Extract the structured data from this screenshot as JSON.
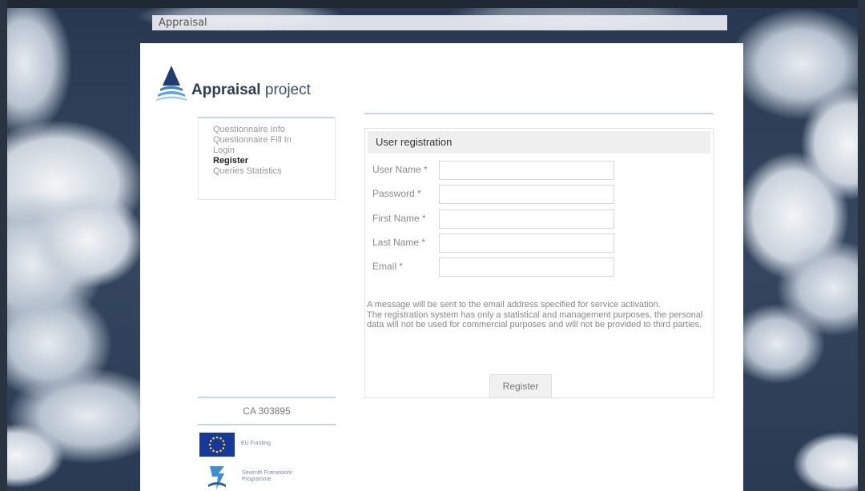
{
  "window_title": "Appraisal",
  "brand": {
    "bold": "Appraisal",
    "light": "project"
  },
  "nav": {
    "items": [
      {
        "label": "Questionnaire Info",
        "active": false
      },
      {
        "label": "Questionnaire Fill In",
        "active": false
      },
      {
        "label": "Login",
        "active": false
      },
      {
        "label": "Register",
        "active": true
      },
      {
        "label": "Queries Statistics",
        "active": false
      }
    ]
  },
  "form": {
    "heading": "User registration",
    "fields": {
      "user_name": {
        "label": "User Name *",
        "value": ""
      },
      "password": {
        "label": "Password *",
        "value": ""
      },
      "first_name": {
        "label": "First Name *",
        "value": ""
      },
      "last_name": {
        "label": "Last Name *",
        "value": ""
      },
      "email": {
        "label": "Email *",
        "value": ""
      }
    },
    "message_line1": "A message will be sent to the email address specified for service activation.",
    "message_line2": "The registration system has only a statistical and management purposes, the personal data will not be used for commercial purposes and will not be provided to third parties.",
    "submit_label": "Register"
  },
  "footer": {
    "grant_code": "CA 303895",
    "eu_funding_label": "EU Funding",
    "fp7_label": "Seventh Framework Programme"
  },
  "colors": {
    "accent_rule": "#c5d8e8",
    "brand_text": "#2c3e50",
    "eu_flag_blue": "#16379b",
    "eu_star_yellow": "#ffdd00"
  },
  "icons": {
    "logo": "appraisal-logo-icon",
    "eu_flag": "eu-flag-icon",
    "fp7": "fp7-logo-icon"
  }
}
